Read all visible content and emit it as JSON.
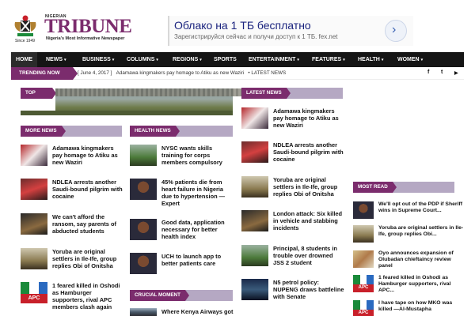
{
  "header": {
    "logo_top": "NIGERIAN",
    "logo_name": "TRIBUNE",
    "logo_since": "Since 1949",
    "logo_tagline": "Nigeria's Most Informative Newspaper"
  },
  "ad": {
    "headline": "Облако на 1 ТБ бесплатно",
    "subtext": "Зарегистрируйся сейчас и получи доступ к 1 ТБ. fex.net",
    "arrow": "›"
  },
  "nav": {
    "items": [
      {
        "label": "Home"
      },
      {
        "label": "News"
      },
      {
        "label": "Business"
      },
      {
        "label": "Columns"
      },
      {
        "label": "Regions"
      },
      {
        "label": "Sports"
      },
      {
        "label": "Entertainment"
      },
      {
        "label": "Features"
      },
      {
        "label": "Health"
      },
      {
        "label": "Women"
      }
    ],
    "caret": "▾"
  },
  "trending": {
    "label": "TRENDING NOW",
    "date": "[ June 4, 2017 ]",
    "headline": "Adamawa kingmakers pay homage to Atiku as new Waziri",
    "more": "LATEST NEWS",
    "social": [
      "f",
      "t",
      "▶"
    ]
  },
  "sections": {
    "top_news": "Top News",
    "latest_news": "Latest News",
    "more_news": "More News",
    "health_news": "Health News",
    "most_read": "Most Read",
    "crucial_moment": "Crucial Moment"
  },
  "more_news": [
    {
      "title": "Adamawa kingmakers pay homage to Atiku as new Waziri",
      "thumb": "red-crowd"
    },
    {
      "title": "NDLEA arrests another Saudi-bound pilgrim with cocaine",
      "thumb": "crowd"
    },
    {
      "title": "We can't afford the ransom, say parents of abducted students",
      "thumb": "dark"
    },
    {
      "title": "Yoruba are original settlers in Ile-Ife, group replies Obi of Onitsha",
      "thumb": "building"
    },
    {
      "title": "1 feared killed in Oshodi as Hamburger supporters, rival APC members clash again",
      "thumb": "apc-flag"
    }
  ],
  "health_news": [
    {
      "title": "NYSC wants skills training for corps members compulsory",
      "thumb": "green"
    },
    {
      "title": "45% patients die from heart failure in Nigeria due to hypertension — Expert",
      "thumb": "portrait"
    },
    {
      "title": "Good data, application necessary for better health index",
      "thumb": "portrait"
    },
    {
      "title": "UCH to launch app to better patients care",
      "thumb": "portrait"
    }
  ],
  "latest_news": [
    {
      "title": "Adamawa kingmakers pay homage to Atiku as new Waziri",
      "thumb": "red-crowd"
    },
    {
      "title": "NDLEA arrests another Saudi-bound pilgrim with cocaine",
      "thumb": "crowd"
    },
    {
      "title": "Yoruba are original settlers in Ile-Ife, group replies Obi of Onitsha",
      "thumb": "building"
    },
    {
      "title": "London attack: Six killed in vehicle and stabbing incidents",
      "thumb": "dark"
    },
    {
      "title": "Principal, 8 students in trouble over drowned JSS 2 student",
      "thumb": "green"
    },
    {
      "title": "N5 petrol policy: NUPENG draws battleline with Senate",
      "thumb": "night"
    }
  ],
  "most_read": [
    {
      "title": "We'll opt out of the PDP if Sheriff wins in Supreme Court...",
      "thumb": "portrait"
    },
    {
      "title": "Yoruba are original settlers in Ile-Ife, group replies Obi...",
      "thumb": "building"
    },
    {
      "title": "Oyo announces expansion of Olubadan chieftaincy review panel",
      "thumb": "map"
    },
    {
      "title": "1 feared killed in Oshodi as Hamburger supporters, rival APC...",
      "thumb": "apc-flag"
    },
    {
      "title": "I have tape on how MKO was killed —Al-Mustapha",
      "thumb": "apc-flag"
    }
  ],
  "crucial": [
    {
      "title": "Where Kenya Airways got"
    }
  ],
  "colors": {
    "brand": "#7b2c6d",
    "brand_light": "#b5a8c3",
    "nav_bg": "#151515"
  }
}
